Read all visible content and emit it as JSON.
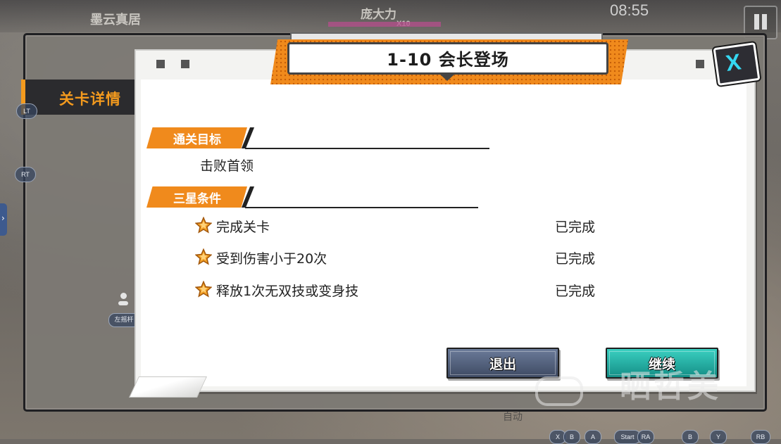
{
  "hud": {
    "top_left_label": "墨云真居",
    "player_name": "庞大力",
    "combo_text": "X10",
    "time": "08:55",
    "auto_label": "自动"
  },
  "side_tab": {
    "label": "关卡详情"
  },
  "controller": {
    "lt": "LT",
    "rt": "RT",
    "left_stick": "左摇杆",
    "bottom_buttons": [
      "X",
      "B",
      "A",
      "Start",
      "RA",
      "B",
      "Y",
      "RB"
    ]
  },
  "dialog": {
    "title": "1-10 会长登场",
    "close_label": "X",
    "goal_header": "通关目标",
    "goal_text": "击败首领",
    "stars_header": "三星条件",
    "conditions": [
      {
        "text": "完成关卡",
        "status": "已完成"
      },
      {
        "text": "受到伤害小于20次",
        "status": "已完成"
      },
      {
        "text": "释放1次无双技或变身技",
        "status": "已完成"
      }
    ],
    "exit_button": "退出",
    "continue_button": "继续"
  },
  "watermark": {
    "text": "晒哲美"
  },
  "colors": {
    "accent_orange": "#f08a1c",
    "exit_blue": "#4e5c78",
    "continue_teal": "#22b0a5",
    "close_cyan": "#35d8f2"
  }
}
